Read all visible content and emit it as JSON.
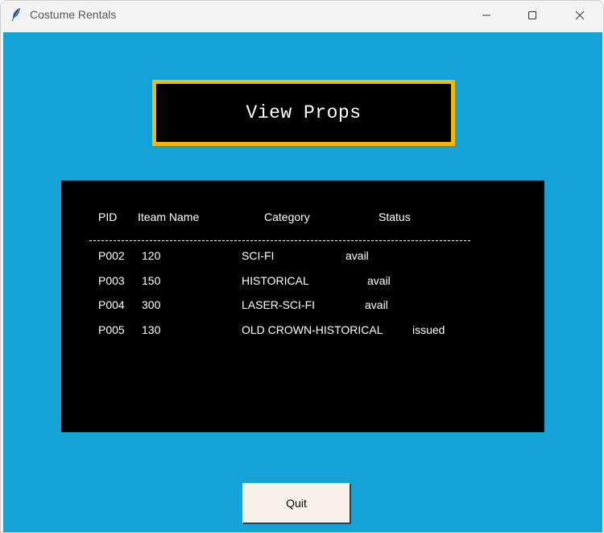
{
  "window": {
    "title": "Costume Rentals",
    "icon": "feather-icon",
    "controls": [
      "minimize-icon",
      "maximize-icon",
      "close-icon"
    ]
  },
  "heading": "View Props",
  "table": {
    "headers": [
      "PID",
      "Iteam Name",
      "Category",
      "Status"
    ],
    "rows": [
      [
        "P002",
        "120",
        "SCI-FI",
        "avail"
      ],
      [
        "P003",
        "150",
        "HISTORICAL",
        "avail"
      ],
      [
        "P004",
        "300",
        "LASER-SCI-FI",
        "avail"
      ],
      [
        "P005",
        "130",
        "OLD CROWN-HISTORICAL",
        "issued"
      ]
    ]
  },
  "quit_label": "Quit",
  "colors": {
    "background": "#13a3d7",
    "heading_border": "#f5b800",
    "panel": "#000000",
    "button": "#f6f1e6"
  }
}
